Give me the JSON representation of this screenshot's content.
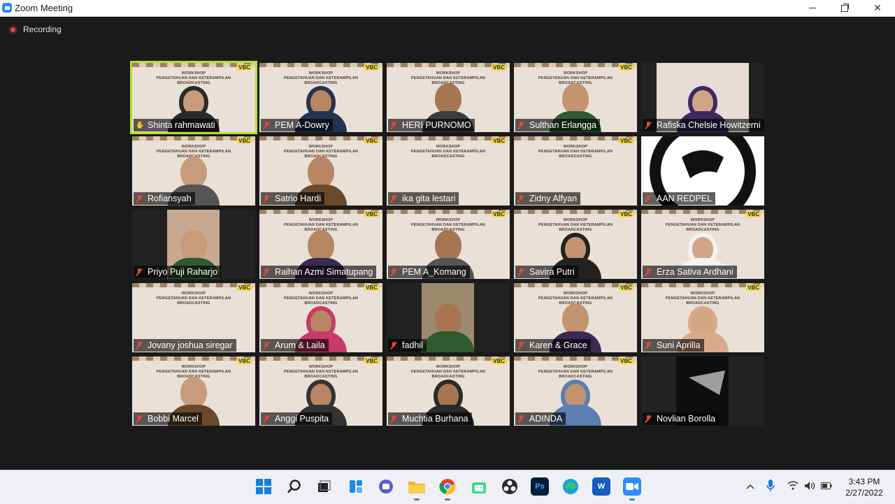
{
  "window": {
    "title": "Zoom Meeting"
  },
  "recording": {
    "label": "Recording"
  },
  "participants": [
    {
      "name": "Shinta rahmawati"
    },
    {
      "name": "PEM A-Dowry"
    },
    {
      "name": "HERI PURNOMO"
    },
    {
      "name": "Sulthan Erlangga"
    },
    {
      "name": "Rafiska Chelsie Howitzerni"
    },
    {
      "name": "Rofiansyah"
    },
    {
      "name": "Satrio Hardi"
    },
    {
      "name": "ika gita lestari"
    },
    {
      "name": "Zidny Alfyan"
    },
    {
      "name": "AAN REDPEL"
    },
    {
      "name": "Priyo Puji Raharjo"
    },
    {
      "name": "Raihan Azmi Simatupang"
    },
    {
      "name": "PEM A_Komang"
    },
    {
      "name": "Savira Putri"
    },
    {
      "name": "Erza Sativa Ardhani"
    },
    {
      "name": "Jovany joshua siregar"
    },
    {
      "name": "Arum & Laila"
    },
    {
      "name": "fadhil"
    },
    {
      "name": "Karen & Grace"
    },
    {
      "name": "Suni Aprilla"
    },
    {
      "name": "Bobbi Marcel"
    },
    {
      "name": "Anggi Puspita"
    },
    {
      "name": "Muchtia Burhana"
    },
    {
      "name": "ADINDA"
    },
    {
      "name": "Novlian Borolla"
    }
  ],
  "background_text": {
    "line1": "WORKSHOP",
    "line2": "PENGETAHUAN DAN KETERAMPILAN",
    "line3": "BROADCASTING",
    "logo": "VBC"
  },
  "taskbar": {
    "apps": [
      "start-icon",
      "search-icon",
      "task-view-icon",
      "widgets-icon",
      "chat-icon",
      "file-explorer-icon",
      "chrome-icon",
      "android-icon",
      "obs-icon",
      "photoshop-icon",
      "edge-icon",
      "word-icon",
      "zoom-icon"
    ],
    "photoshop_label": "Ps",
    "word_label": "W"
  },
  "clock": {
    "time": "3:43 PM",
    "date": "2/27/2022"
  },
  "colors": {
    "active_speaker": "#b8e02b",
    "zoom_blue": "#2d8cff",
    "muted_red": "#e4473c"
  }
}
